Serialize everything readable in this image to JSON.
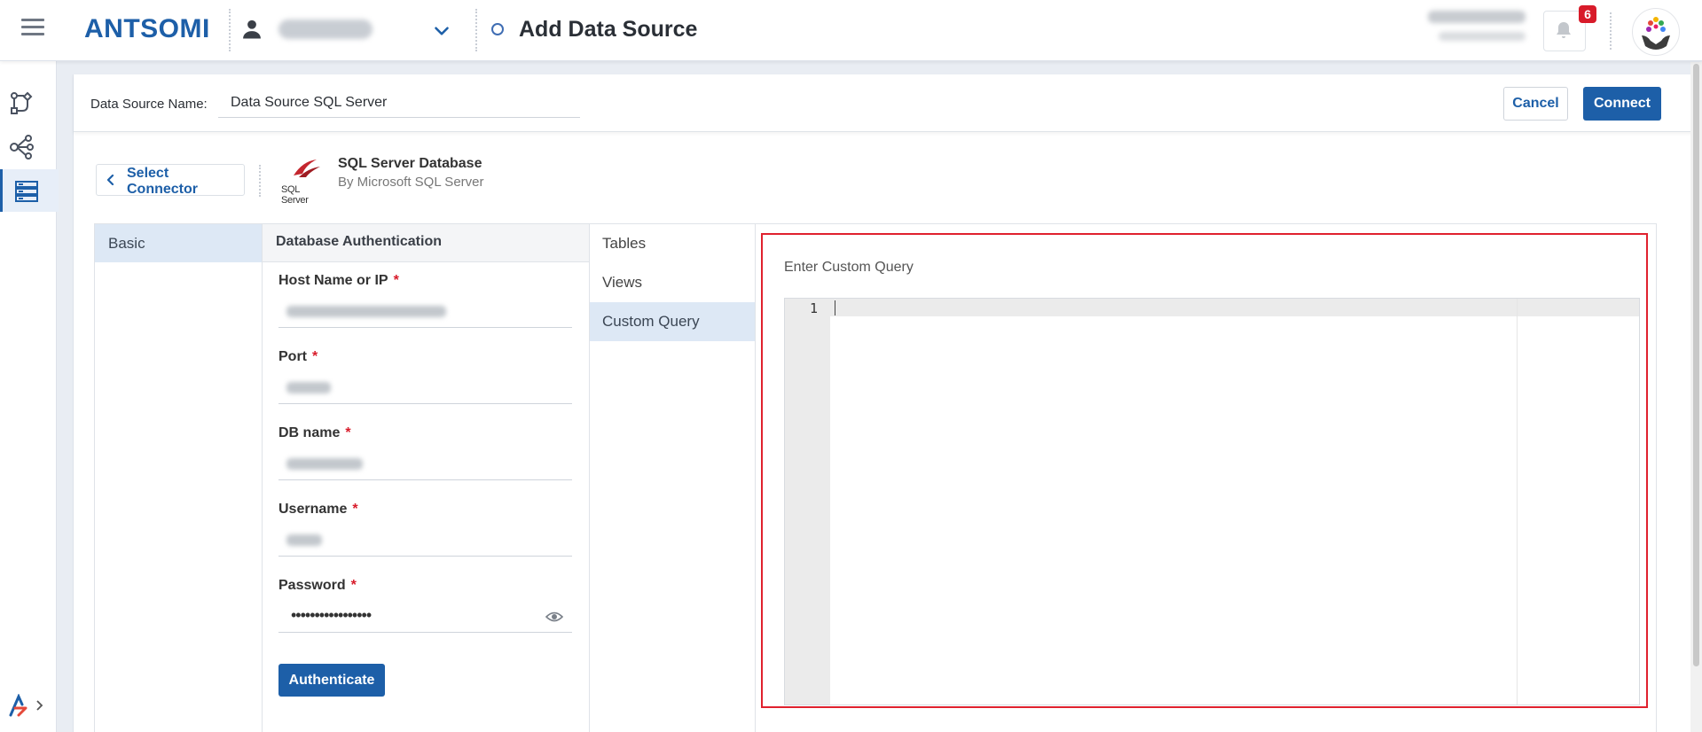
{
  "app": {
    "logo_text": "ANTSOMI",
    "page_title": "Add Data Source",
    "notification_count": "6",
    "accent_color": "#1d5fa8",
    "alert_color": "#d81b2a"
  },
  "sidebar": {
    "items": [
      {
        "icon": "workflow-icon",
        "active": false
      },
      {
        "icon": "share-nodes-icon",
        "active": false
      },
      {
        "icon": "data-source-icon",
        "active": true
      }
    ]
  },
  "header": {
    "name_label": "Data Source Name:",
    "name_value": "Data Source SQL Server",
    "cancel_label": "Cancel",
    "connect_label": "Connect"
  },
  "connector": {
    "back_label": "Select Connector",
    "logo_text": "SQL Server",
    "name": "SQL Server Database",
    "vendor": "By Microsoft SQL Server"
  },
  "left_tabs": [
    {
      "label": "Basic",
      "active": true
    }
  ],
  "auth": {
    "title": "Database Authentication",
    "fields": [
      {
        "label": "Host Name or IP",
        "required_mark": "*"
      },
      {
        "label": "Port",
        "required_mark": "*"
      },
      {
        "label": "DB name",
        "required_mark": "*"
      },
      {
        "label": "Username",
        "required_mark": "*"
      },
      {
        "label": "Password",
        "required_mark": "*",
        "masked_value": "•••••••••••••••••"
      }
    ],
    "authenticate_label": "Authenticate"
  },
  "query_tabs": [
    {
      "label": "Tables",
      "active": false
    },
    {
      "label": "Views",
      "active": false
    },
    {
      "label": "Custom Query",
      "active": true
    }
  ],
  "editor": {
    "label": "Enter Custom Query",
    "line_numbers": [
      "1"
    ],
    "content": ""
  }
}
